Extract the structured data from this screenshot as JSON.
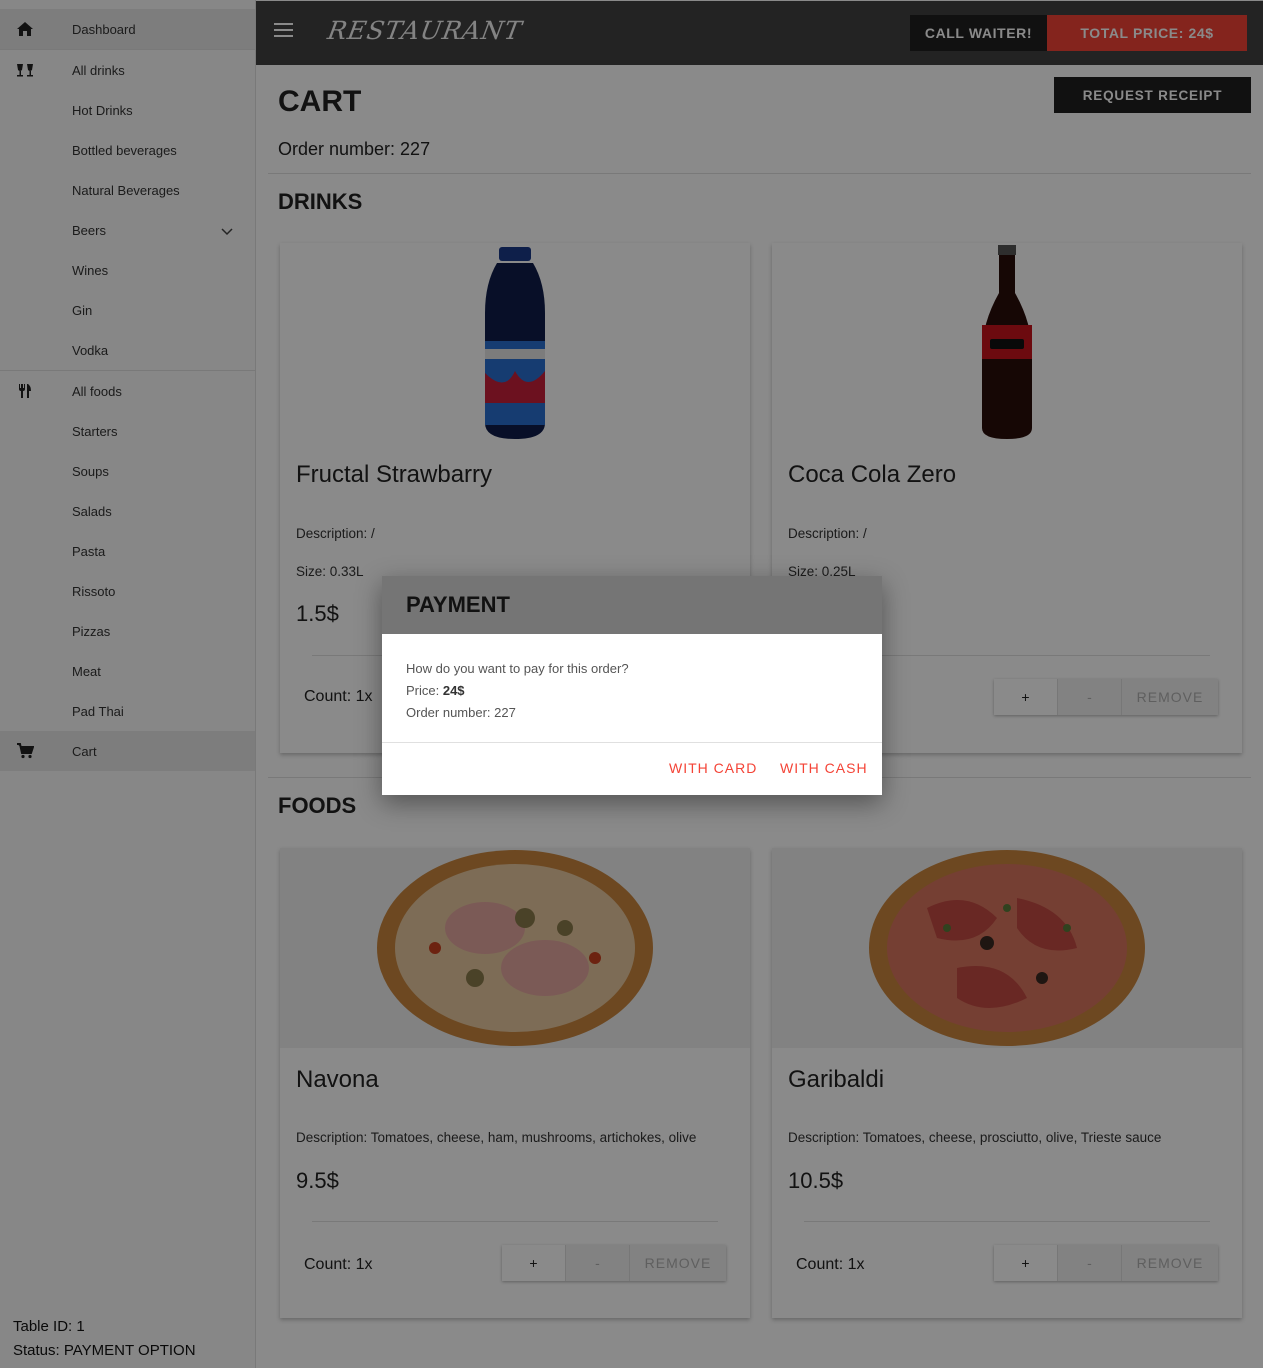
{
  "sidebar": {
    "items": [
      {
        "label": "Dashboard",
        "icon": "home-icon"
      },
      {
        "label": "All drinks",
        "icon": "drinks-icon"
      },
      {
        "label": "Hot Drinks"
      },
      {
        "label": "Bottled beverages"
      },
      {
        "label": "Natural Beverages"
      },
      {
        "label": "Beers",
        "icon": "chevron-down-icon"
      },
      {
        "label": "Wines"
      },
      {
        "label": "Gin"
      },
      {
        "label": "Vodka"
      },
      {
        "label": "All foods",
        "icon": "cutlery-icon"
      },
      {
        "label": "Starters"
      },
      {
        "label": "Soups"
      },
      {
        "label": "Salads"
      },
      {
        "label": "Pasta"
      },
      {
        "label": "Rissoto"
      },
      {
        "label": "Pizzas"
      },
      {
        "label": "Meat"
      },
      {
        "label": "Pad Thai"
      },
      {
        "label": "Cart",
        "icon": "cart-icon"
      }
    ],
    "table_id": "Table ID: 1",
    "status": "Status: PAYMENT OPTION"
  },
  "topbar": {
    "logo": "RESTAURANT",
    "call_waiter": "CALL WAITER!",
    "total_price": "TOTAL PRICE: 24$"
  },
  "main": {
    "title": "CART",
    "request_receipt": "REQUEST RECEIPT",
    "order_number": "Order number: 227",
    "drinks_title": "DRINKS",
    "foods_title": "FOODS",
    "drinks": [
      {
        "name": "Fructal Strawbarry",
        "description": "Description: /",
        "size": "Size: 0.33L",
        "price": "1.5$",
        "count": "Count: 1x"
      },
      {
        "name": "Coca Cola Zero",
        "description": "Description: /",
        "size": "Size: 0.25L",
        "price": "",
        "count": ""
      }
    ],
    "foods": [
      {
        "name": "Navona",
        "description": "Description: Tomatoes, cheese, ham, mushrooms, artichokes, olive",
        "price": "9.5$",
        "count": "Count: 1x"
      },
      {
        "name": "Garibaldi",
        "description": "Description: Tomatoes, cheese, prosciutto, olive, Trieste sauce",
        "price": "10.5$",
        "count": "Count: 1x"
      }
    ],
    "btn_plus": "+",
    "btn_minus": "-",
    "btn_remove": "REMOVE"
  },
  "dialog": {
    "title": "PAYMENT",
    "question": "How do you want to pay for this order?",
    "price_label": "Price: ",
    "price_value": "24$",
    "order_number": "Order number: 227",
    "with_card": "WITH CARD",
    "with_cash": "WITH CASH"
  },
  "colors": {
    "accent": "#f44336",
    "topbar": "#424242",
    "dark_button": "#212121"
  }
}
